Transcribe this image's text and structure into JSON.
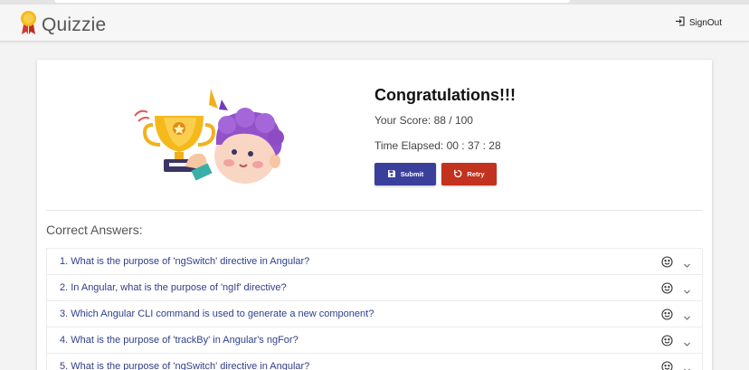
{
  "app": {
    "title": "Quizzie",
    "signout_label": "SignOut"
  },
  "result": {
    "heading": "Congratulations!!!",
    "score_text": "Your Score: 88 / 100",
    "time_text": "Time Elapsed: 00 : 37 : 28"
  },
  "buttons": {
    "submit_label": "Submit",
    "retry_label": "Retry"
  },
  "answers": {
    "title": "Correct Answers:",
    "questions": [
      "1. What is the purpose of 'ngSwitch' directive in Angular?",
      "2. In Angular, what is the purpose of 'ngIf' directive?",
      "3. Which Angular CLI command is used to generate a new component?",
      "4. What is the purpose of 'trackBy' in Angular's ngFor?",
      "5. What is the purpose of 'ngSwitch' directive in Angular?"
    ]
  },
  "colors": {
    "primary": "#3a3f9c",
    "danger": "#c2321e",
    "question_text": "#2f3e8c"
  },
  "icons": [
    "medal-icon",
    "signout-icon",
    "trophy-illustration",
    "save-icon",
    "retry-icon",
    "smile-icon",
    "chevron-down-icon"
  ]
}
